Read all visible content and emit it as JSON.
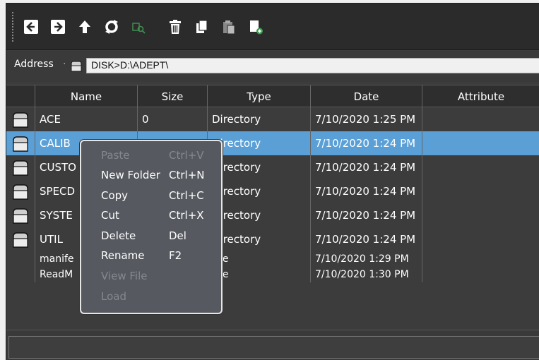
{
  "toolbar": {
    "buttons": [
      {
        "icon": "back-arrow-icon",
        "enabled": true
      },
      {
        "icon": "forward-arrow-icon",
        "enabled": true
      },
      {
        "icon": "up-arrow-icon",
        "enabled": true
      },
      {
        "icon": "refresh-icon",
        "enabled": true
      },
      {
        "icon": "find-icon",
        "enabled": false
      },
      {
        "icon": "trash-icon",
        "enabled": true
      },
      {
        "icon": "copy-icon",
        "enabled": true
      },
      {
        "icon": "paste-icon",
        "enabled": false
      },
      {
        "icon": "new-folder-icon",
        "enabled": true
      }
    ]
  },
  "address": {
    "label": "Address",
    "value": "DISK>D:\\ADEPT\\"
  },
  "table": {
    "columns": [
      "Name",
      "Size",
      "Type",
      "Date",
      "Attribute"
    ],
    "rows": [
      {
        "name": "ACE",
        "size": "0",
        "type": "Directory",
        "date": "7/10/2020 1:25 PM",
        "attribute": "",
        "folder": true,
        "selected": false
      },
      {
        "name": "CALIB",
        "size": "",
        "type": "Directory",
        "date": "7/10/2020 1:24 PM",
        "attribute": "",
        "folder": true,
        "selected": true
      },
      {
        "name": "CUSTO",
        "size": "",
        "type": "Directory",
        "date": "7/10/2020 1:24 PM",
        "attribute": "",
        "folder": true,
        "selected": false
      },
      {
        "name": "SPECD",
        "size": "",
        "type": "Directory",
        "date": "7/10/2020 1:24 PM",
        "attribute": "",
        "folder": true,
        "selected": false
      },
      {
        "name": "SYSTE",
        "size": "",
        "type": "Directory",
        "date": "7/10/2020 1:24 PM",
        "attribute": "",
        "folder": true,
        "selected": false
      },
      {
        "name": "UTIL",
        "size": "",
        "type": "Directory",
        "date": "7/10/2020 1:24 PM",
        "attribute": "",
        "folder": true,
        "selected": false
      },
      {
        "name": "manife",
        "size": "",
        "type": "File",
        "date": "7/10/2020 1:29 PM",
        "attribute": "",
        "folder": false,
        "selected": false
      },
      {
        "name": "ReadM",
        "size": "",
        "type": "File",
        "date": "7/10/2020 1:30 PM",
        "attribute": "",
        "folder": false,
        "selected": false
      }
    ]
  },
  "context_menu": {
    "items": [
      {
        "label": "Paste",
        "shortcut": "Ctrl+V",
        "enabled": false
      },
      {
        "label": "New Folder",
        "shortcut": "Ctrl+N",
        "enabled": true
      },
      {
        "label": "Copy",
        "shortcut": "Ctrl+C",
        "enabled": true
      },
      {
        "label": "Cut",
        "shortcut": "Ctrl+X",
        "enabled": true
      },
      {
        "label": "Delete",
        "shortcut": "Del",
        "enabled": true
      },
      {
        "label": "Rename",
        "shortcut": "F2",
        "enabled": true
      },
      {
        "label": "View File",
        "shortcut": "",
        "enabled": false
      },
      {
        "label": "Load",
        "shortcut": "",
        "enabled": false
      }
    ]
  },
  "status": {
    "text": ""
  },
  "colors": {
    "background": "#3c3c3c",
    "selection": "#5a9fd6",
    "disabled_text": "#858890",
    "enabled_icon": "#ffffff",
    "disabled_icon": "#3f8f4f"
  }
}
